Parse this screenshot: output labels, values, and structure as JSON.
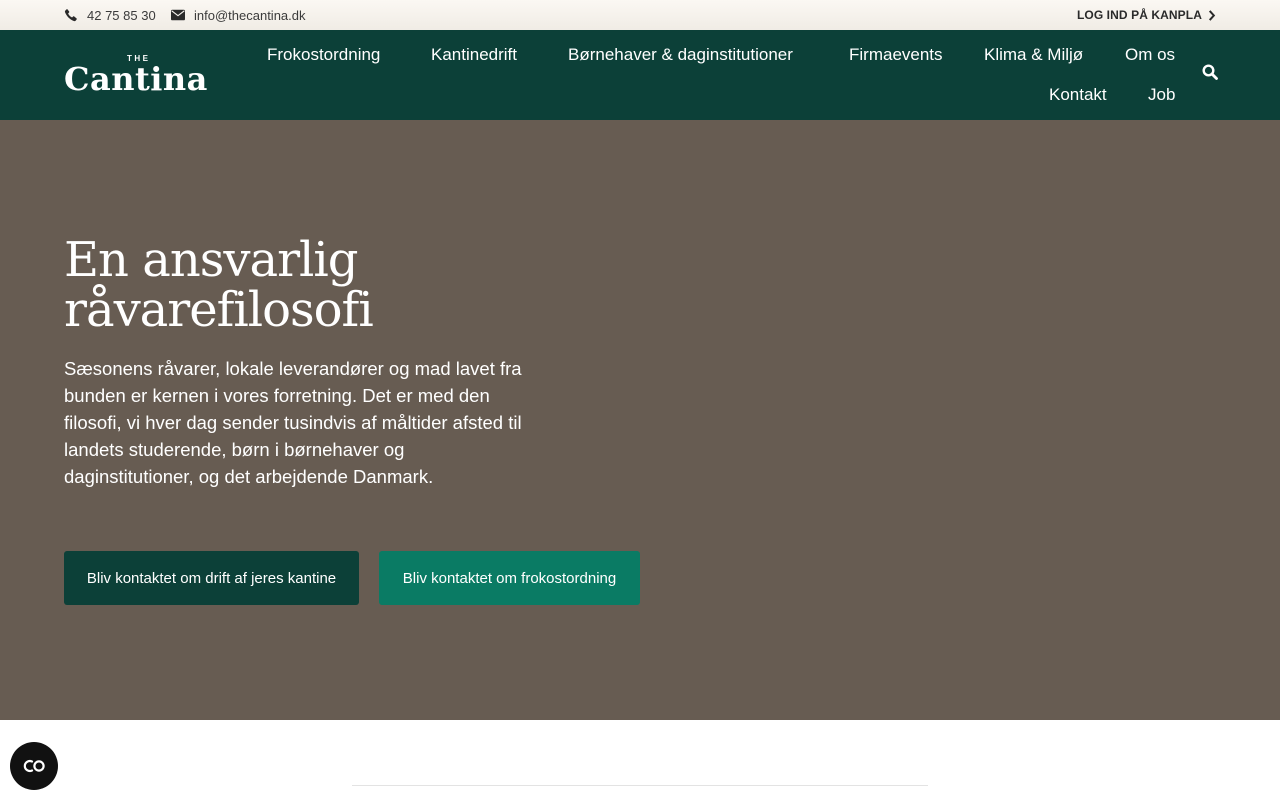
{
  "topbar": {
    "phone": "42 75 85 30",
    "email": "info@thecantina.dk",
    "login_label": "LOG IND PÅ KANPLA"
  },
  "brand": {
    "the": "THE",
    "name": "Cantina"
  },
  "nav": {
    "items": [
      "Frokostordning",
      "Kantinedrift",
      "Børnehaver & daginstitutioner",
      "Firmaevents",
      "Klima & Miljø",
      "Om os",
      "Kontakt",
      "Job"
    ]
  },
  "hero": {
    "title": "En ansvarlig råvarefilosofi",
    "text": "Sæsonens råvarer, lokale leverandører og mad lavet fra bunden er kernen i vores forretning. Det er med den filosofi, vi hver dag sender tusindvis af måltider afsted til landets studerende, børn i børnehaver og daginstitutioner, og det arbejdende Danmark.",
    "button_primary": "Bliv kontaktet om drift af jeres kantine",
    "button_secondary": "Bliv kontaktet om frokostordning"
  },
  "icons": {
    "phone": "phone-icon",
    "email": "envelope-icon",
    "login": "chevron-right-icon",
    "search": "search-icon",
    "cookie": "cookie-consent-icon"
  },
  "colors": {
    "nav_bg": "#0c4038",
    "hero_bg": "#675c52",
    "button_primary": "#0c4038",
    "button_secondary": "#0a7b64"
  }
}
